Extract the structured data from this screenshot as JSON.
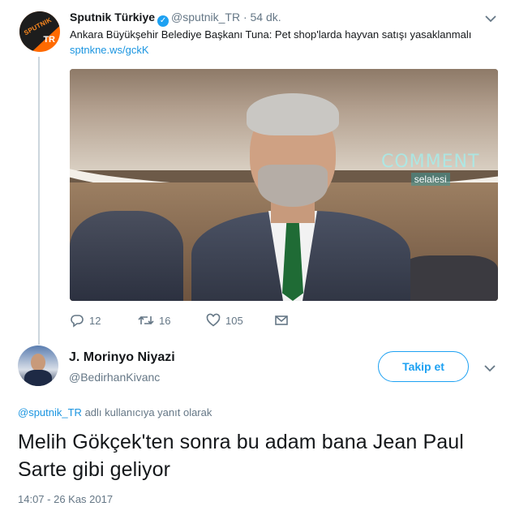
{
  "parent_tweet": {
    "author_name": "Sputnik Türkiye",
    "handle": "@sputnik_TR",
    "separator": "·",
    "time_ago": "54 dk.",
    "text": "Ankara Büyükşehir Belediye Başkanı Tuna: Pet shop'larda hayvan satışı yasaklanmalı",
    "link": "sptnkne.ws/gckK",
    "avatar_label": "SPUTNIK",
    "avatar_badge": "TR",
    "media_watermark_1": "COMMENT",
    "media_watermark_2": "selalesi",
    "actions": {
      "reply_count": "12",
      "retweet_count": "16",
      "like_count": "105"
    }
  },
  "reply_tweet": {
    "author_name": "J. Morinyo Niyazi",
    "handle": "@BedirhanKivanc",
    "follow_label": "Takip et",
    "reply_mention": "@sputnik_TR",
    "reply_context_suffix": " adlı kullanıcıya yanıt olarak",
    "text": "Melih Gökçek'ten sonra bu adam bana Jean Paul Sarte gibi geliyor",
    "timestamp": "14:07 - 26 Kas 2017"
  },
  "colors": {
    "accent": "#1da1f2",
    "link": "#1b95e0",
    "muted": "#657786",
    "text": "#14171a",
    "thread_line": "#ccd6dd"
  },
  "icons": {
    "verified": "verified-badge-icon",
    "menu": "chevron-down-icon",
    "reply": "reply-icon",
    "retweet": "retweet-icon",
    "like": "heart-icon",
    "message": "envelope-icon"
  }
}
